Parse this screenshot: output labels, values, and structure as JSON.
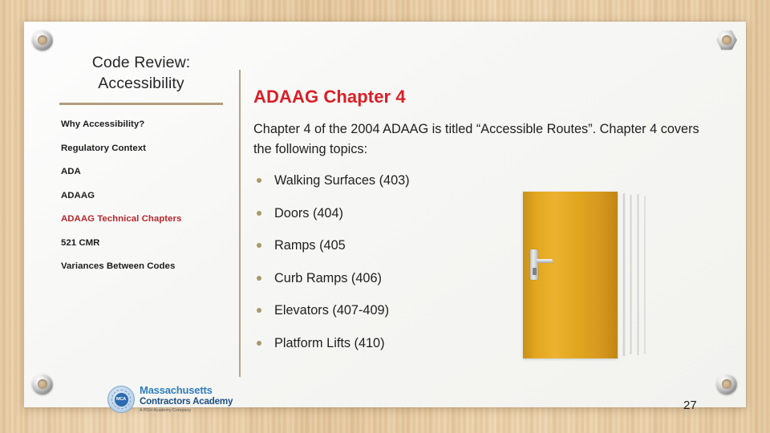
{
  "slide": {
    "page_number": "27"
  },
  "sidebar": {
    "deck_title_line1": "Code Review:",
    "deck_title_line2": "Accessibility",
    "items": [
      {
        "label": "Why Accessibility?",
        "active": false
      },
      {
        "label": "Regulatory Context",
        "active": false
      },
      {
        "label": "ADA",
        "active": false
      },
      {
        "label": "ADAAG",
        "active": false
      },
      {
        "label": "ADAAG Technical Chapters",
        "active": true
      },
      {
        "label": "521 CMR",
        "active": false
      },
      {
        "label": "Variances Between Codes",
        "active": false
      }
    ]
  },
  "content": {
    "heading": "ADAAG Chapter 4",
    "intro": "Chapter 4 of the 2004 ADAAG is titled “Accessible Routes”. Chapter 4 covers the following topics:",
    "topics": [
      "Walking Surfaces (403)",
      "Doors (404)",
      "Ramps (405",
      "Curb Ramps (406)",
      "Elevators (407-409)",
      "Platform Lifts (410)"
    ]
  },
  "logo": {
    "seal_text": "MCA",
    "line1": "Massachusetts",
    "line2": "Contractors Academy",
    "tagline": "A PDH Academy Company"
  },
  "colors": {
    "heading_red": "#d91f26",
    "active_nav_red": "#b5272d",
    "rule_tan": "#b09f7d",
    "bullet_tan": "#a89968",
    "door_wood": "#e6a719"
  }
}
